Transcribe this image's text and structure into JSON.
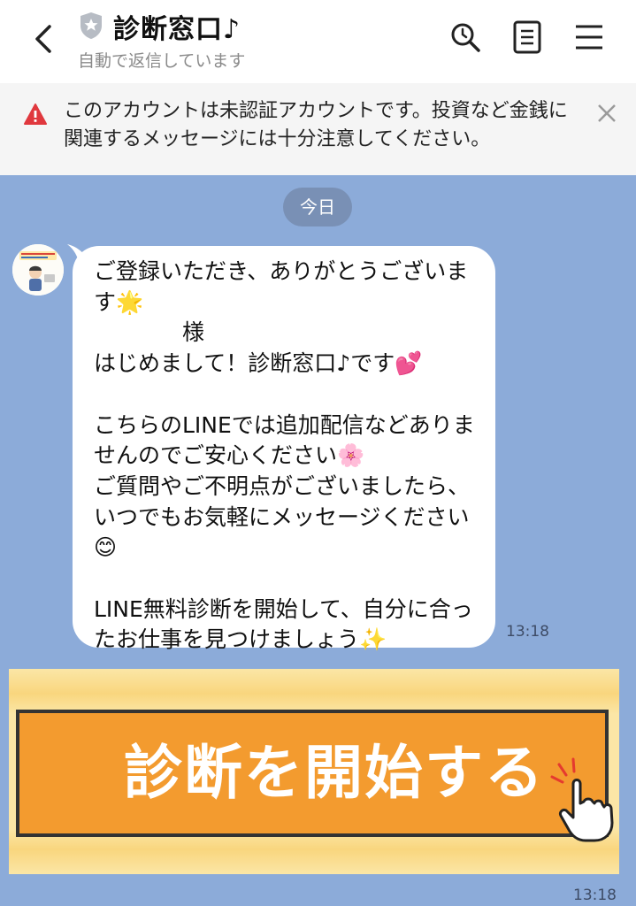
{
  "header": {
    "title": "診断窓口♪",
    "subtitle": "自動で返信しています"
  },
  "notice": {
    "text": "このアカウントは未認証アカウントです。投資など金銭に関連するメッセージには十分注意してください。"
  },
  "chat": {
    "date": "今日",
    "messages": [
      {
        "text": "ご登録いただき、ありがとうございます🌟\n　　　　様\nはじめまして！診断窓口♪です💕\n\nこちらのLINEでは追加配信などありませんのでご安心ください🌸\nご質問やご不明点がございましたら、いつでもお気軽にメッセージください😊\n\nLINE無料診断を開始して、自分に合ったお仕事を見つけましょう✨",
        "time": "13:18"
      }
    ],
    "banner": {
      "label": "診断を開始する",
      "time": "13:18"
    }
  },
  "colors": {
    "chat_bg": "#8cabd9",
    "banner_orange": "#f39b2f",
    "banner_yellow": "#fbe6a6",
    "warning_red": "#e0383e"
  },
  "icons": [
    "back-arrow-icon",
    "shield-icon",
    "search-icon",
    "notes-icon",
    "menu-icon",
    "warning-icon",
    "close-icon",
    "pointing-hand-icon"
  ]
}
